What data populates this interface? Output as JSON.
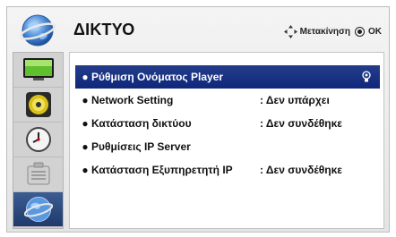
{
  "header": {
    "title": "ΔΙΚΤΥΟ",
    "move_hint": "Μετακίνηση",
    "ok_hint": "OK"
  },
  "sidebar": {
    "items": [
      {
        "icon": "tv-picture-icon"
      },
      {
        "icon": "speaker-icon"
      },
      {
        "icon": "clock-icon"
      },
      {
        "icon": "options-icon"
      },
      {
        "icon": "network-globe-icon",
        "active": true
      }
    ]
  },
  "menu": {
    "items": [
      {
        "bullet": "●",
        "label": "Ρύθμιση Ονόματος Player",
        "value": "",
        "selected": true
      },
      {
        "bullet": "●",
        "label": "Network Setting",
        "value": ": Δεν υπάρχει"
      },
      {
        "bullet": "●",
        "label": "Κατάσταση δικτύου",
        "value": ": Δεν συνδέθηκε"
      },
      {
        "bullet": "●",
        "label": "Ρυθμίσεις IP Server",
        "value": ""
      },
      {
        "bullet": "●",
        "label": "Κατάσταση Εξυπηρετητή IP",
        "value": ": Δεν συνδέθηκε"
      }
    ]
  },
  "colors": {
    "selected_row": "#1a3185",
    "active_sidebar": "#2c4a80",
    "panel_bg": "#ffffff",
    "frame_bg": "#ececec"
  }
}
